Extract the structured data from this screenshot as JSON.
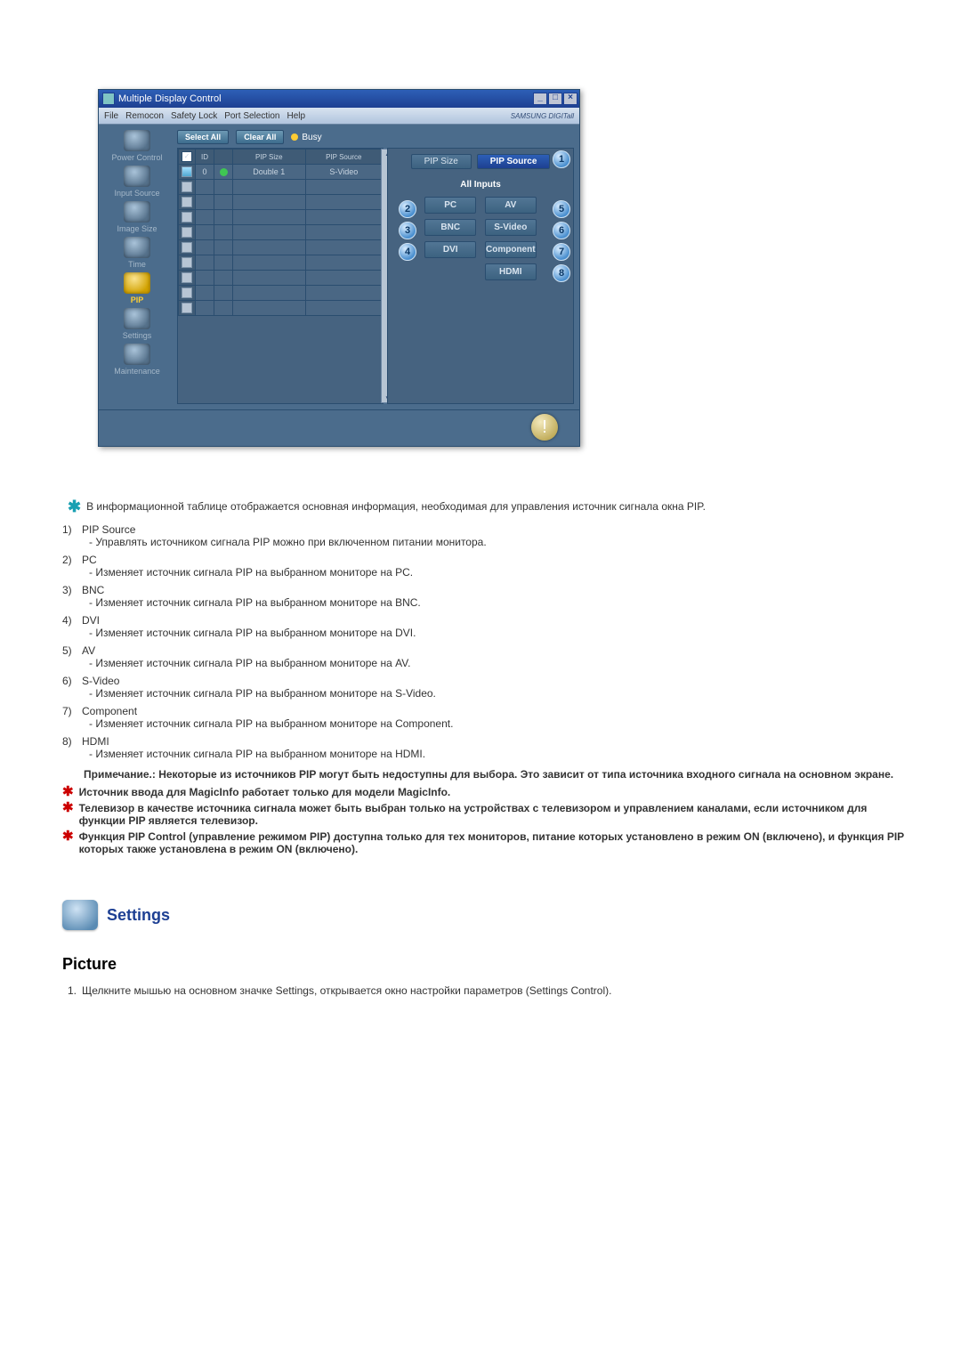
{
  "app": {
    "title": "Multiple Display Control",
    "brand": "SAMSUNG DIGITall",
    "menu": [
      "File",
      "Remocon",
      "Safety Lock",
      "Port Selection",
      "Help"
    ],
    "sidebar": [
      {
        "label": "Power Control"
      },
      {
        "label": "Input Source"
      },
      {
        "label": "Image Size"
      },
      {
        "label": "Time"
      },
      {
        "label": "PIP"
      },
      {
        "label": "Settings"
      },
      {
        "label": "Maintenance"
      }
    ],
    "select_all": "Select All",
    "clear_all": "Clear All",
    "busy": "Busy",
    "table_headers": {
      "cb": " ",
      "id": "ID",
      "status_icon": " ",
      "pip_size": "PIP Size",
      "pip_source": "PIP Source"
    },
    "table_rows": [
      {
        "checked": true,
        "filled": true,
        "id": "0",
        "status": "green",
        "pip_size": "Double 1",
        "pip_source": "S-Video"
      },
      {
        "checked": false,
        "filled": false,
        "id": "",
        "status": "",
        "pip_size": "",
        "pip_source": ""
      },
      {
        "checked": false,
        "filled": false,
        "id": "",
        "status": "",
        "pip_size": "",
        "pip_source": ""
      },
      {
        "checked": false,
        "filled": false,
        "id": "",
        "status": "",
        "pip_size": "",
        "pip_source": ""
      },
      {
        "checked": false,
        "filled": false,
        "id": "",
        "status": "",
        "pip_size": "",
        "pip_source": ""
      },
      {
        "checked": false,
        "filled": false,
        "id": "",
        "status": "",
        "pip_size": "",
        "pip_source": ""
      },
      {
        "checked": false,
        "filled": false,
        "id": "",
        "status": "",
        "pip_size": "",
        "pip_source": ""
      },
      {
        "checked": false,
        "filled": false,
        "id": "",
        "status": "",
        "pip_size": "",
        "pip_source": ""
      },
      {
        "checked": false,
        "filled": false,
        "id": "",
        "status": "",
        "pip_size": "",
        "pip_source": ""
      },
      {
        "checked": false,
        "filled": false,
        "id": "",
        "status": "",
        "pip_size": "",
        "pip_source": ""
      }
    ],
    "cp_tabs": [
      "PIP Size",
      "PIP Source"
    ],
    "cp_active": 1,
    "all_inputs": "All Inputs",
    "inputs": [
      "PC",
      "AV",
      "BNC",
      "S-Video",
      "DVI",
      "Component",
      "HDMI"
    ],
    "callouts": {
      "tab": "1",
      "pc": "2",
      "bnc": "3",
      "dvi": "4",
      "av": "5",
      "svideo": "6",
      "component": "7",
      "hdmi": "8"
    },
    "win_buttons": {
      "min": "_",
      "max": "□",
      "close": "×"
    }
  },
  "doc": {
    "intro": "В информационной таблице отображается основная информация, необходимая для управления источник сигнала окна PIP.",
    "items": [
      {
        "n": "1)",
        "title": "PIP Source",
        "desc": "- Управлять источником сигнала PIP можно при включенном питании монитора."
      },
      {
        "n": "2)",
        "title": "PC",
        "desc": "- Изменяет источник сигнала PIP на выбранном мониторе на PC."
      },
      {
        "n": "3)",
        "title": "BNC",
        "desc": "- Изменяет источник сигнала PIP на выбранном мониторе на BNC."
      },
      {
        "n": "4)",
        "title": "DVI",
        "desc": "- Изменяет источник сигнала PIP на выбранном мониторе на DVI."
      },
      {
        "n": "5)",
        "title": "AV",
        "desc": "- Изменяет источник сигнала PIP на выбранном мониторе на AV."
      },
      {
        "n": "6)",
        "title": "S-Video",
        "desc": "- Изменяет источник сигнала PIP на выбранном мониторе на S-Video."
      },
      {
        "n": "7)",
        "title": "Component",
        "desc": "- Изменяет источник сигнала PIP на выбранном мониторе на Component."
      },
      {
        "n": "8)",
        "title": "HDMI",
        "desc": "- Изменяет источник сигнала PIP на выбранном мониторе на HDMI."
      }
    ],
    "note": "Примечание.: Некоторые из источников PIP могут быть недоступны для выбора. Это зависит от типа источника входного сигнала на основном экране.",
    "red_notes": [
      "Источник ввода для MagicInfo работает только для модели MagicInfo.",
      "Телевизор в качестве источника сигнала может быть выбран только на устройствах с телевизором и управлением каналами, если источником для функции PIP является телевизор.",
      "Функция PIP Control (управление режимом PIP) доступна только для тех мониторов, питание которых установлено в режим ON (включено), и функция PIP которых также установлена в режим ON (включено)."
    ],
    "section_title": "Settings",
    "h3": "Picture",
    "ol": [
      "Щелкните мышью на основном значке Settings, открывается окно настройки параметров (Settings Control)."
    ]
  }
}
